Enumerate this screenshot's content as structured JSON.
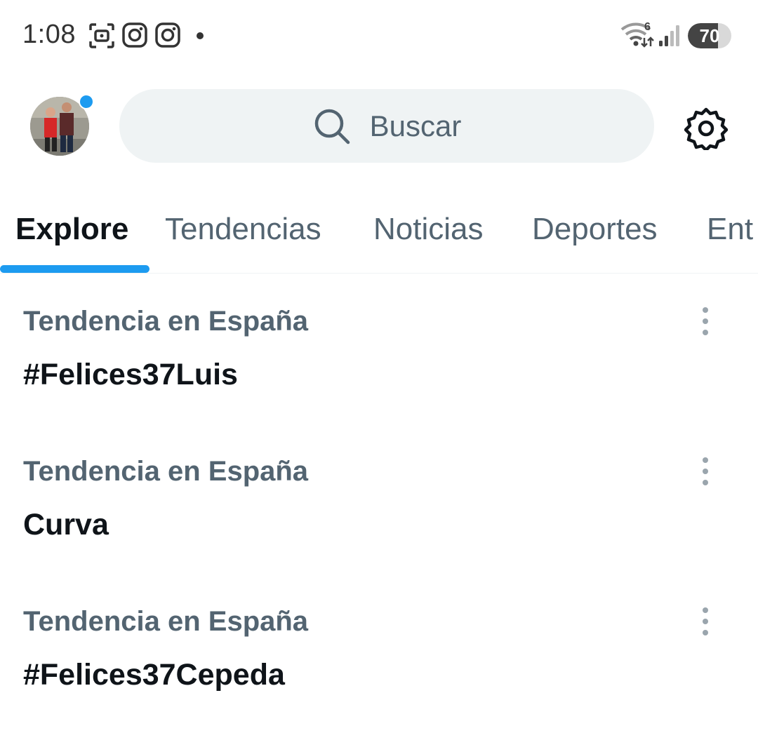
{
  "status_bar": {
    "time": "1:08",
    "battery": "70",
    "battery_level": 0.7,
    "signal_label": "6",
    "icons": [
      "screenshot-icon",
      "instagram-icon",
      "instagram-icon",
      "notification-dot",
      "wifi-icon",
      "cellular-signal-icon",
      "battery-icon"
    ]
  },
  "header": {
    "search_placeholder": "Buscar",
    "accent_color": "#1d9bf0"
  },
  "tabs": [
    {
      "label": "Explore",
      "active": true
    },
    {
      "label": "Tendencias",
      "active": false
    },
    {
      "label": "Noticias",
      "active": false
    },
    {
      "label": "Deportes",
      "active": false
    },
    {
      "label": "Ent",
      "active": false
    }
  ],
  "trends": [
    {
      "context": "Tendencia en España",
      "title": "#Felices37Luis"
    },
    {
      "context": "Tendencia en España",
      "title": "Curva"
    },
    {
      "context": "Tendencia en España",
      "title": "#Felices37Cepeda"
    }
  ]
}
